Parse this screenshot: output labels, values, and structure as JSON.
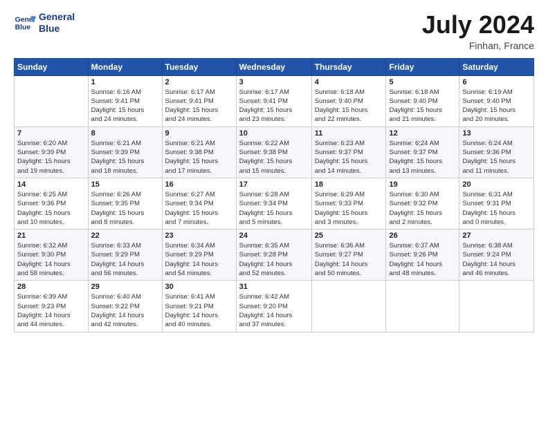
{
  "header": {
    "logo_line1": "General",
    "logo_line2": "Blue",
    "month_title": "July 2024",
    "location": "Finhan, France"
  },
  "weekdays": [
    "Sunday",
    "Monday",
    "Tuesday",
    "Wednesday",
    "Thursday",
    "Friday",
    "Saturday"
  ],
  "weeks": [
    [
      {
        "day": "",
        "info": ""
      },
      {
        "day": "1",
        "info": "Sunrise: 6:16 AM\nSunset: 9:41 PM\nDaylight: 15 hours\nand 24 minutes."
      },
      {
        "day": "2",
        "info": "Sunrise: 6:17 AM\nSunset: 9:41 PM\nDaylight: 15 hours\nand 24 minutes."
      },
      {
        "day": "3",
        "info": "Sunrise: 6:17 AM\nSunset: 9:41 PM\nDaylight: 15 hours\nand 23 minutes."
      },
      {
        "day": "4",
        "info": "Sunrise: 6:18 AM\nSunset: 9:40 PM\nDaylight: 15 hours\nand 22 minutes."
      },
      {
        "day": "5",
        "info": "Sunrise: 6:18 AM\nSunset: 9:40 PM\nDaylight: 15 hours\nand 21 minutes."
      },
      {
        "day": "6",
        "info": "Sunrise: 6:19 AM\nSunset: 9:40 PM\nDaylight: 15 hours\nand 20 minutes."
      }
    ],
    [
      {
        "day": "7",
        "info": "Sunrise: 6:20 AM\nSunset: 9:39 PM\nDaylight: 15 hours\nand 19 minutes."
      },
      {
        "day": "8",
        "info": "Sunrise: 6:21 AM\nSunset: 9:39 PM\nDaylight: 15 hours\nand 18 minutes."
      },
      {
        "day": "9",
        "info": "Sunrise: 6:21 AM\nSunset: 9:38 PM\nDaylight: 15 hours\nand 17 minutes."
      },
      {
        "day": "10",
        "info": "Sunrise: 6:22 AM\nSunset: 9:38 PM\nDaylight: 15 hours\nand 15 minutes."
      },
      {
        "day": "11",
        "info": "Sunrise: 6:23 AM\nSunset: 9:37 PM\nDaylight: 15 hours\nand 14 minutes."
      },
      {
        "day": "12",
        "info": "Sunrise: 6:24 AM\nSunset: 9:37 PM\nDaylight: 15 hours\nand 13 minutes."
      },
      {
        "day": "13",
        "info": "Sunrise: 6:24 AM\nSunset: 9:36 PM\nDaylight: 15 hours\nand 11 minutes."
      }
    ],
    [
      {
        "day": "14",
        "info": "Sunrise: 6:25 AM\nSunset: 9:36 PM\nDaylight: 15 hours\nand 10 minutes."
      },
      {
        "day": "15",
        "info": "Sunrise: 6:26 AM\nSunset: 9:35 PM\nDaylight: 15 hours\nand 8 minutes."
      },
      {
        "day": "16",
        "info": "Sunrise: 6:27 AM\nSunset: 9:34 PM\nDaylight: 15 hours\nand 7 minutes."
      },
      {
        "day": "17",
        "info": "Sunrise: 6:28 AM\nSunset: 9:34 PM\nDaylight: 15 hours\nand 5 minutes."
      },
      {
        "day": "18",
        "info": "Sunrise: 6:29 AM\nSunset: 9:33 PM\nDaylight: 15 hours\nand 3 minutes."
      },
      {
        "day": "19",
        "info": "Sunrise: 6:30 AM\nSunset: 9:32 PM\nDaylight: 15 hours\nand 2 minutes."
      },
      {
        "day": "20",
        "info": "Sunrise: 6:31 AM\nSunset: 9:31 PM\nDaylight: 15 hours\nand 0 minutes."
      }
    ],
    [
      {
        "day": "21",
        "info": "Sunrise: 6:32 AM\nSunset: 9:30 PM\nDaylight: 14 hours\nand 58 minutes."
      },
      {
        "day": "22",
        "info": "Sunrise: 6:33 AM\nSunset: 9:29 PM\nDaylight: 14 hours\nand 56 minutes."
      },
      {
        "day": "23",
        "info": "Sunrise: 6:34 AM\nSunset: 9:29 PM\nDaylight: 14 hours\nand 54 minutes."
      },
      {
        "day": "24",
        "info": "Sunrise: 6:35 AM\nSunset: 9:28 PM\nDaylight: 14 hours\nand 52 minutes."
      },
      {
        "day": "25",
        "info": "Sunrise: 6:36 AM\nSunset: 9:27 PM\nDaylight: 14 hours\nand 50 minutes."
      },
      {
        "day": "26",
        "info": "Sunrise: 6:37 AM\nSunset: 9:26 PM\nDaylight: 14 hours\nand 48 minutes."
      },
      {
        "day": "27",
        "info": "Sunrise: 6:38 AM\nSunset: 9:24 PM\nDaylight: 14 hours\nand 46 minutes."
      }
    ],
    [
      {
        "day": "28",
        "info": "Sunrise: 6:39 AM\nSunset: 9:23 PM\nDaylight: 14 hours\nand 44 minutes."
      },
      {
        "day": "29",
        "info": "Sunrise: 6:40 AM\nSunset: 9:22 PM\nDaylight: 14 hours\nand 42 minutes."
      },
      {
        "day": "30",
        "info": "Sunrise: 6:41 AM\nSunset: 9:21 PM\nDaylight: 14 hours\nand 40 minutes."
      },
      {
        "day": "31",
        "info": "Sunrise: 6:42 AM\nSunset: 9:20 PM\nDaylight: 14 hours\nand 37 minutes."
      },
      {
        "day": "",
        "info": ""
      },
      {
        "day": "",
        "info": ""
      },
      {
        "day": "",
        "info": ""
      }
    ]
  ]
}
